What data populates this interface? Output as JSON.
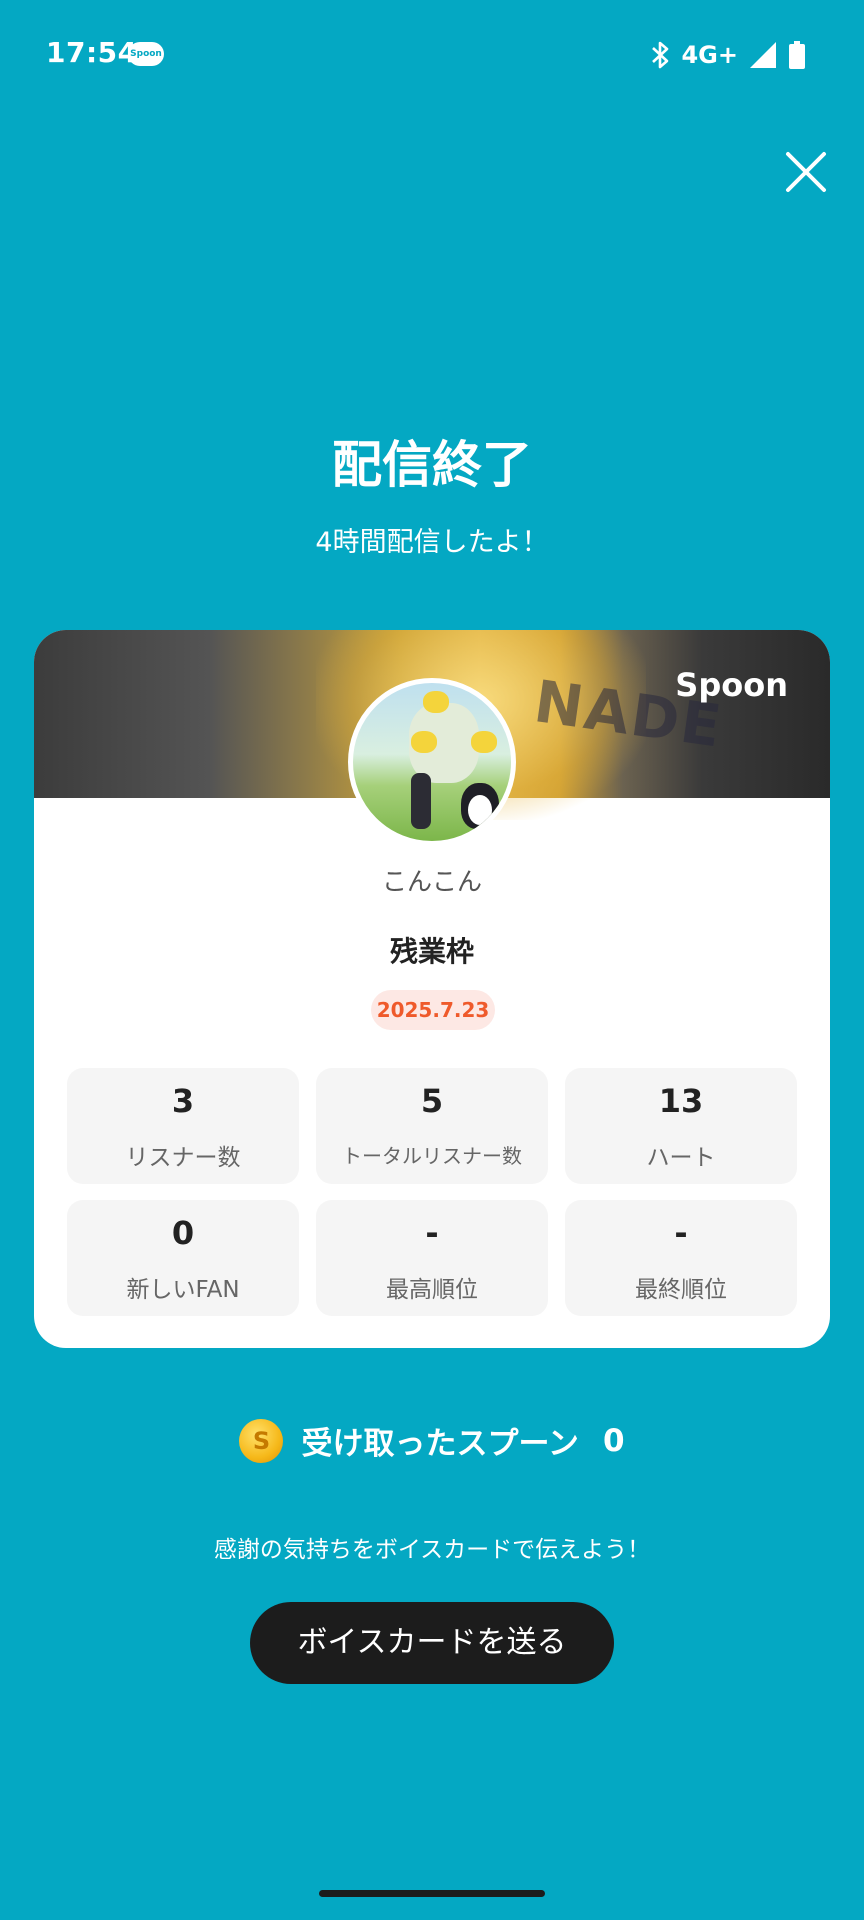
{
  "status_bar": {
    "time": "17:54",
    "app_icon_label": "Spoon",
    "network": "4G+",
    "icons": [
      "bluetooth-icon",
      "signal-icon",
      "battery-icon"
    ]
  },
  "close_icon": "close-icon",
  "header": {
    "title": "配信終了",
    "subtitle": "4時間配信したよ！"
  },
  "card": {
    "cover_text": "NADE",
    "logo": "Spoon",
    "username": "こんこん",
    "live_title": "残業枠",
    "date": "2025.7.23",
    "stats": [
      {
        "value": "3",
        "label": "リスナー数"
      },
      {
        "value": "5",
        "label": "トータルリスナー数"
      },
      {
        "value": "13",
        "label": "ハート"
      },
      {
        "value": "0",
        "label": "新しいFAN"
      },
      {
        "value": "-",
        "label": "最高順位"
      },
      {
        "value": "-",
        "label": "最終順位"
      }
    ]
  },
  "spoons": {
    "coin_symbol": "S",
    "label": "受け取ったスプーン",
    "count": "0"
  },
  "thanks_text": "感謝の気持ちをボイスカードで伝えよう！",
  "voice_card_button": "ボイスカードを送る",
  "colors": {
    "background": "#04a8c3",
    "accent": "#ef5a2b",
    "button": "#1c1c1c"
  }
}
